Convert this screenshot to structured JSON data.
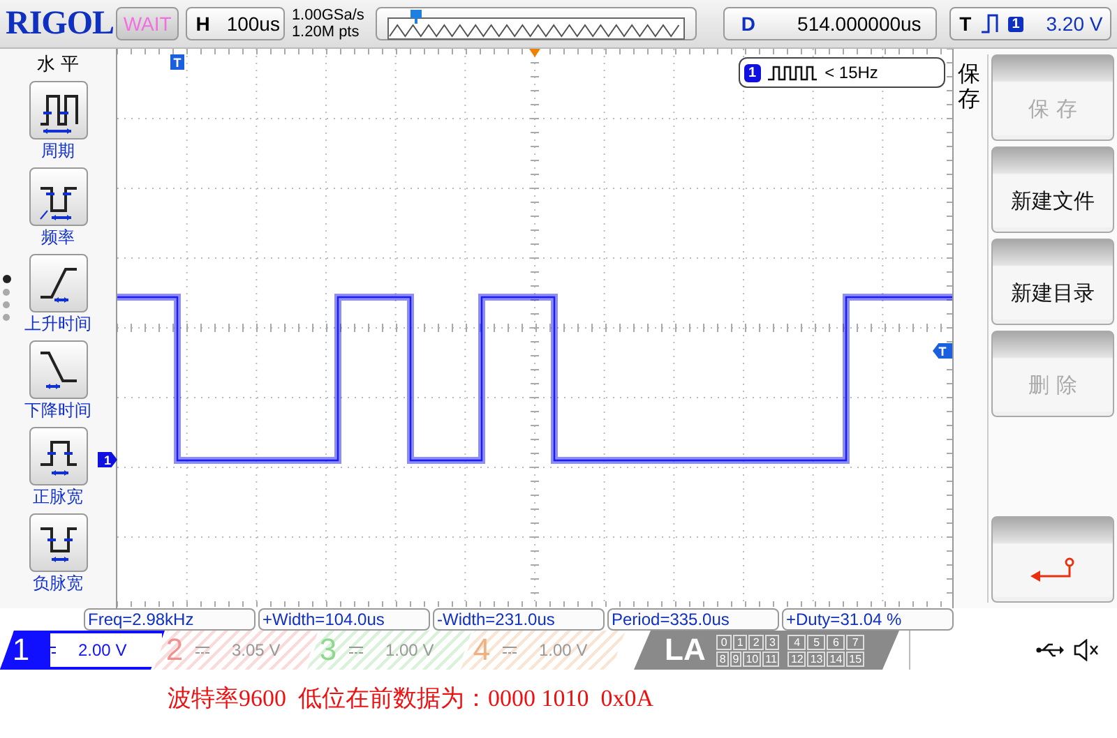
{
  "top_bar": {
    "logo": "RIGOL",
    "run_status": "WAIT",
    "timebase": {
      "label": "H",
      "value": "100us"
    },
    "sample_rate": "1.00GSa/s",
    "memory_depth": "1.20M pts",
    "delay": {
      "label": "D",
      "value": "514.000000us"
    },
    "trigger": {
      "label": "T",
      "source": "1",
      "level": "3.20 V"
    }
  },
  "left_menu": {
    "title": "水 平",
    "items": [
      {
        "kind": "period",
        "label": "周期"
      },
      {
        "kind": "frequency",
        "label": "频率"
      },
      {
        "kind": "rise",
        "label": "上升时间"
      },
      {
        "kind": "fall",
        "label": "下降时间"
      },
      {
        "kind": "positive-width",
        "label": "正脉宽"
      },
      {
        "kind": "negative-width",
        "label": "负脉宽"
      }
    ],
    "pages": [
      {
        "selected": true
      },
      {
        "selected": false
      },
      {
        "selected": false
      },
      {
        "selected": false
      }
    ]
  },
  "display": {
    "trigger_position_marker": "T",
    "channel_marker": "1",
    "trigger_level_marker": "T",
    "counter": {
      "channel": "1",
      "reading": "< 15Hz"
    }
  },
  "softkeys": {
    "title": "保存",
    "buttons": [
      {
        "kind": "text",
        "label": "保 存",
        "disabled": true
      },
      {
        "kind": "text",
        "label": "新建文件",
        "disabled": false
      },
      {
        "kind": "text",
        "label": "新建目录",
        "disabled": false
      },
      {
        "kind": "text",
        "label": "删 除",
        "disabled": true
      },
      {
        "kind": "return"
      }
    ]
  },
  "measurements": [
    "Freq=2.98kHz",
    "+Width=104.0us",
    "-Width=231.0us",
    "Period=335.0us",
    "+Duty=31.04 %"
  ],
  "channels": [
    {
      "number": "1",
      "scale": "2.00 V",
      "selected": true,
      "color": "#1010ff"
    },
    {
      "number": "2",
      "scale": "3.05 V",
      "selected": false,
      "color": "#f09090"
    },
    {
      "number": "3",
      "scale": "1.00 V",
      "selected": false,
      "color": "#90d890"
    },
    {
      "number": "4",
      "scale": "1.00 V",
      "selected": false,
      "color": "#f0b080"
    }
  ],
  "la": {
    "label": "LA",
    "groups": [
      [
        "0",
        "1",
        "2",
        "3"
      ],
      [
        "4",
        "5",
        "6",
        "7"
      ],
      [
        "8",
        "9",
        "10",
        "11"
      ],
      [
        "12",
        "13",
        "14",
        "15"
      ]
    ]
  },
  "caption": "波特率9600  低位在前数据为：0000 1010  0x0A"
}
